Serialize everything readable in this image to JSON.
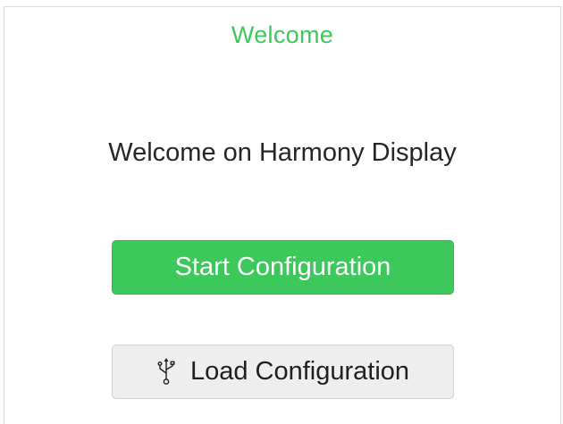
{
  "header": {
    "title": "Welcome"
  },
  "main": {
    "welcome_text": "Welcome on Harmony Display",
    "start_button_label": "Start Configuration",
    "load_button_label": "Load Configuration",
    "load_button_icon": "usb-icon"
  },
  "colors": {
    "accent": "#3cc85a",
    "secondary_button_bg": "#eeeeee"
  }
}
